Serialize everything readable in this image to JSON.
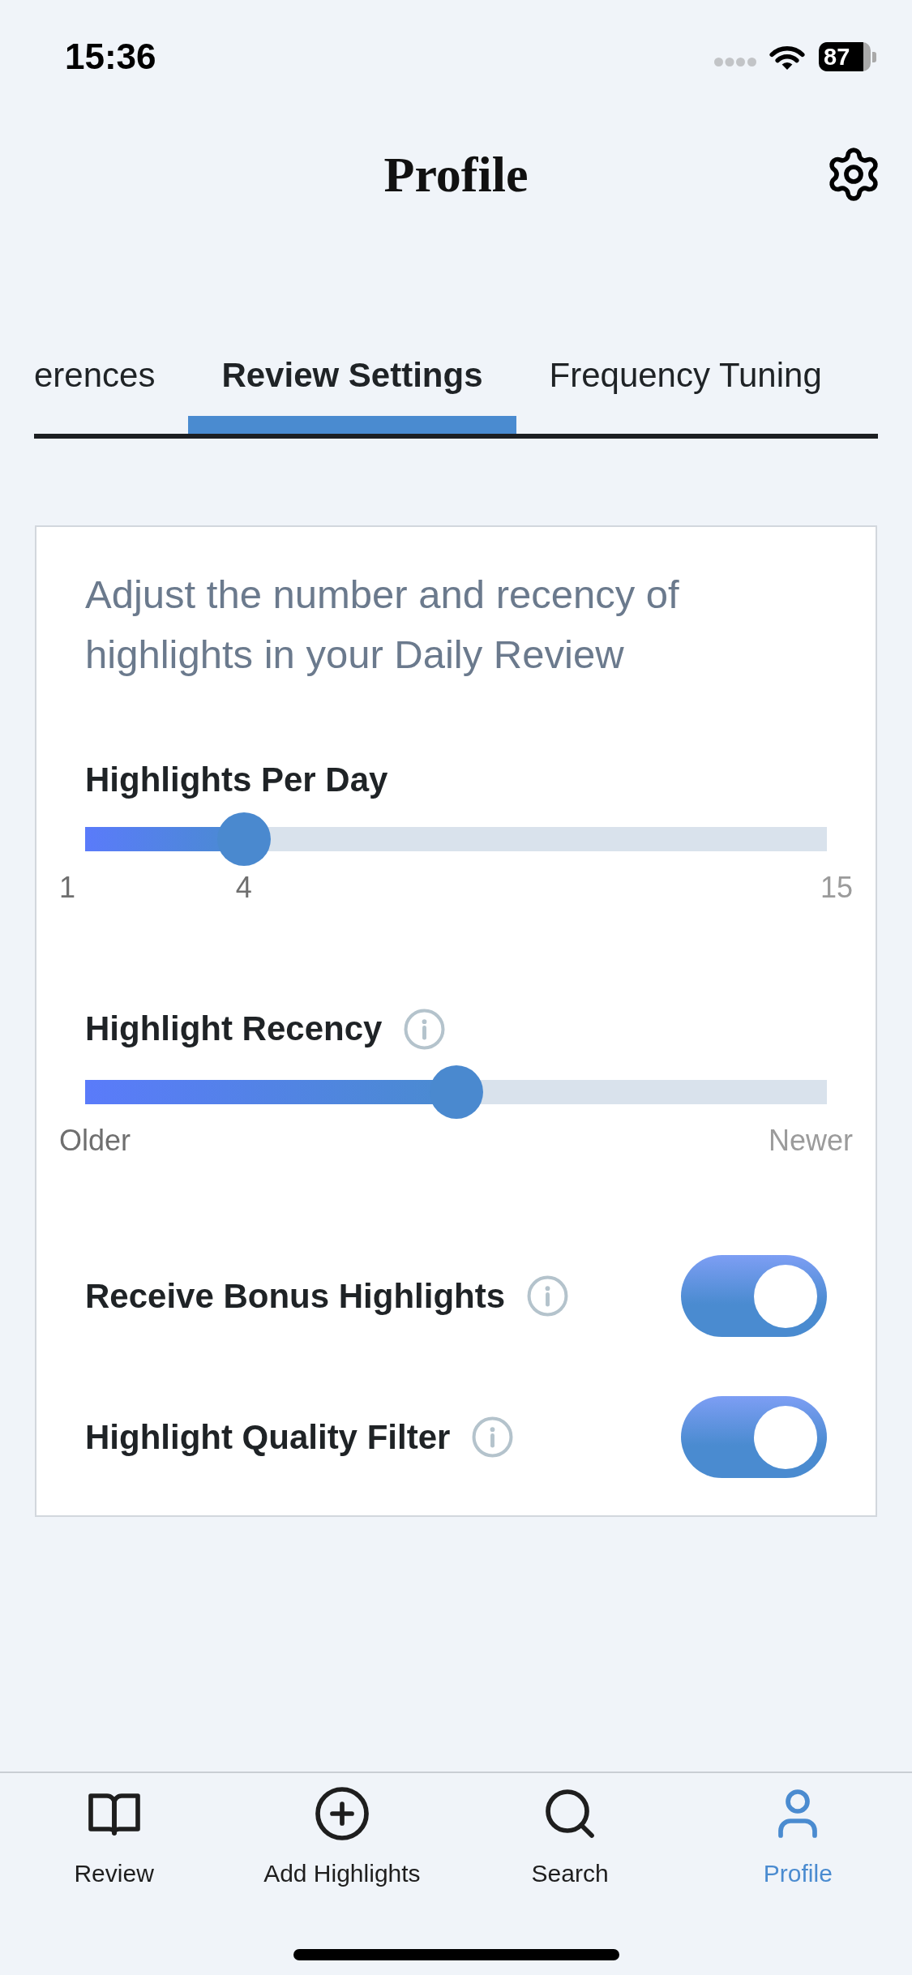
{
  "status_bar": {
    "time": "15:36",
    "battery": "87"
  },
  "header": {
    "title": "Profile"
  },
  "tabs": [
    {
      "label": "erences",
      "selected": false
    },
    {
      "label": "Review Settings",
      "selected": true
    },
    {
      "label": "Frequency Tuning",
      "selected": false
    }
  ],
  "card": {
    "description": "Adjust the number and recency of highlights in your Daily Review",
    "settings": [
      {
        "kind": "slider",
        "label": "Highlights Per Day",
        "level": 0.214,
        "min_label": "1",
        "value_label": "4",
        "max_label": "15"
      },
      {
        "kind": "slider",
        "label": "Highlight Recency",
        "info": true,
        "level": 0.5,
        "min_label": "Older",
        "max_label": "Newer"
      },
      {
        "kind": "toggle",
        "label": "Receive Bonus Highlights",
        "info": true,
        "on": true
      },
      {
        "kind": "toggle",
        "label": "Highlight Quality Filter",
        "info": true,
        "on": true
      }
    ]
  },
  "bottom_nav": [
    {
      "label": "Review",
      "selected": false
    },
    {
      "label": "Add Highlights",
      "selected": false
    },
    {
      "label": "Search",
      "selected": false
    },
    {
      "label": "Profile",
      "selected": true
    }
  ]
}
